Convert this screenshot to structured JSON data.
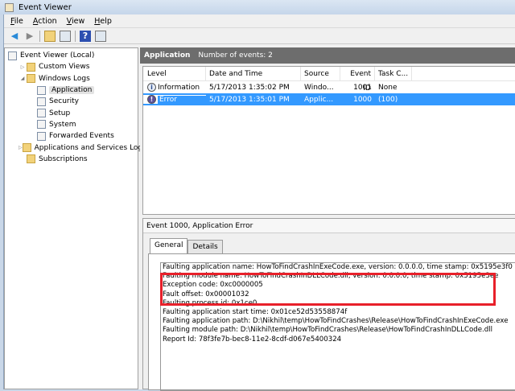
{
  "window": {
    "title": "Event Viewer"
  },
  "menu": [
    "File",
    "Action",
    "View",
    "Help"
  ],
  "tree": [
    {
      "label": "Event Viewer (Local)",
      "icon": "event-viewer-icon",
      "level": 0
    },
    {
      "label": "Custom Views",
      "icon": "folder-icon",
      "level": 1,
      "expander": "▷"
    },
    {
      "label": "Windows Logs",
      "icon": "folder-icon",
      "level": 1,
      "expander": "◢"
    },
    {
      "label": "Application",
      "icon": "log-icon",
      "level": 2,
      "selected": true
    },
    {
      "label": "Security",
      "icon": "log-icon",
      "level": 2
    },
    {
      "label": "Setup",
      "icon": "log-icon",
      "level": 2
    },
    {
      "label": "System",
      "icon": "log-icon",
      "level": 2
    },
    {
      "label": "Forwarded Events",
      "icon": "log-icon",
      "level": 2
    },
    {
      "label": "Applications and Services Logs",
      "icon": "folder-icon",
      "level": 1,
      "expander": "▷"
    },
    {
      "label": "Subscriptions",
      "icon": "folder-icon",
      "level": 1
    }
  ],
  "header": {
    "log": "Application",
    "count": "Number of events: 2"
  },
  "columns": [
    "Level",
    "Date and Time",
    "Source",
    "Event ID",
    "Task C..."
  ],
  "events": [
    {
      "level": "Information",
      "date": "5/17/2013 1:35:02 PM",
      "source": "Windo...",
      "id": "1001",
      "task": "None"
    },
    {
      "level": "Error",
      "date": "5/17/2013 1:35:01 PM",
      "source": "Applic...",
      "id": "1000",
      "task": "(100)"
    }
  ],
  "detail": {
    "title": "Event 1000, Application Error",
    "tabs": [
      "General",
      "Details"
    ],
    "lines": [
      "Faulting application name: HowToFindCrashInExeCode.exe, version: 0.0.0.0, time stamp: 0x5195e3f0",
      "Faulting module name: HowToFindCrashInDLLCode.dll, version: 0.0.0.0, time stamp: 0x5195e3ee",
      "Exception code: 0xc0000005",
      "Fault offset: 0x00001032",
      "Faulting process id: 0x1ce0",
      "Faulting application start time: 0x01ce52d53558874f",
      "Faulting application path: D:\\Nikhil\\temp\\HowToFindCrashes\\Release\\HowToFindCrashInExeCode.exe",
      "Faulting module path: D:\\Nikhil\\temp\\HowToFindCrashes\\Release\\HowToFindCrashInDLLCode.dll",
      "Report Id: 78f3fe7b-bec8-11e2-8cdf-d067e5400324"
    ]
  }
}
